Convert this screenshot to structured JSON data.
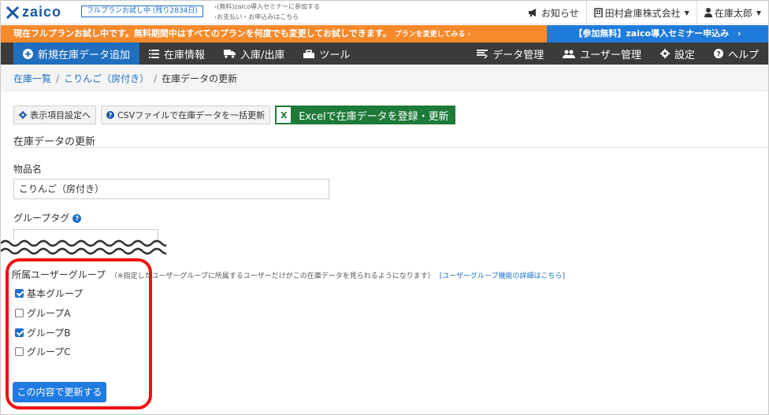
{
  "header": {
    "logo_text": "zaico",
    "trial_badge": "フルプランお試し中 (残り2834日)",
    "links": [
      "›(無料)zaico導入セミナーに参加する",
      "›お支払い・お申込みはこちら"
    ],
    "notifications_label": "お知らせ",
    "company_label": "田村倉庫株式会社",
    "user_label": "在庫太郎"
  },
  "notice": {
    "main_text": "現在フルプランお試し中です。無料期間中はすべてのプランを何度でも変更してお試しできます。",
    "change_link": "プランを変更してみる ›",
    "seminar_text": "【参加無料】zaico導入セミナー申込み　›"
  },
  "nav": {
    "left": [
      {
        "label": "新規在庫データ追加",
        "icon": "plus-circle-icon"
      },
      {
        "label": "在庫情報",
        "icon": "list-icon"
      },
      {
        "label": "入庫/出庫",
        "icon": "truck-icon"
      },
      {
        "label": "ツール",
        "icon": "tools-icon"
      }
    ],
    "right": [
      {
        "label": "データ管理",
        "icon": "data-icon"
      },
      {
        "label": "ユーザー管理",
        "icon": "users-icon"
      },
      {
        "label": "設定",
        "icon": "gear-icon"
      },
      {
        "label": "ヘルプ",
        "icon": "help-icon"
      }
    ]
  },
  "breadcrumb": {
    "items": [
      "在庫一覧",
      "こりんご（房付き）",
      "在庫データの更新"
    ]
  },
  "toolbar": {
    "display_settings": "表示項目設定へ",
    "csv_update": "CSVファイルで在庫データを一括更新",
    "excel_update": "Excelで在庫データを登録・更新",
    "excel_icon_text": "X"
  },
  "form": {
    "section_title": "在庫データの更新",
    "item_name_label": "物品名",
    "item_name_value": "こりんご（房付き）",
    "group_tag_label": "グループタグ",
    "user_group_label": "所属ユーザーグループ",
    "user_group_note": "（※指定したユーザーグループに所属するユーザーだけがこの在庫データを見られるようになります）",
    "user_group_link": "[ユーザーグループ機能の詳細はこちら]",
    "groups": [
      {
        "label": "基本グループ",
        "checked": true
      },
      {
        "label": "グループA",
        "checked": false
      },
      {
        "label": "グループB",
        "checked": true
      },
      {
        "label": "グループC",
        "checked": false
      }
    ],
    "submit_label": "この内容で更新する"
  },
  "colors": {
    "accent": "#1f7be0",
    "notice_orange": "#f6892a",
    "highlight_red": "#ee1111",
    "nav_bg": "#3b3b3b",
    "excel_green": "#1e7a38"
  }
}
